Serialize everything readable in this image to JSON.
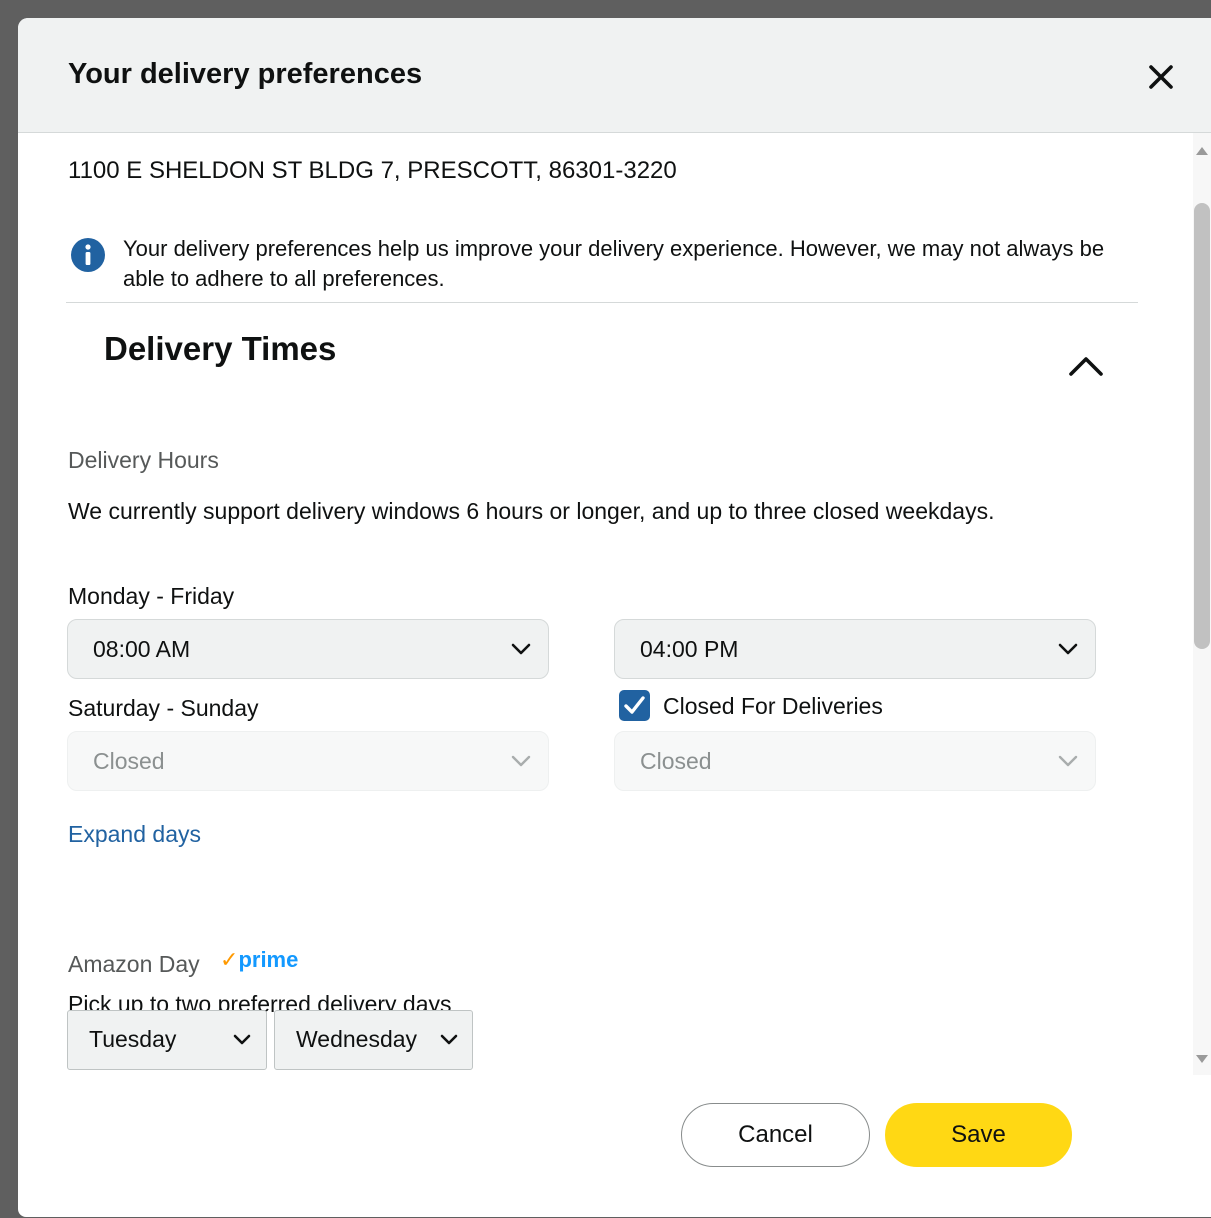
{
  "header": {
    "title": "Your delivery preferences",
    "close_icon": "close-icon"
  },
  "address": "1100 E SHELDON ST BLDG 7, PRESCOTT, 86301-3220",
  "info": {
    "icon": "info-icon",
    "text": "Your delivery preferences help us improve your delivery experience. However, we may not always be able to adhere to all preferences."
  },
  "delivery_times": {
    "title": "Delivery Times",
    "collapse_icon": "chevron-up-icon",
    "hours_label": "Delivery Hours",
    "description": "We currently support delivery windows 6 hours or longer, and up to three closed weekdays.",
    "weekday": {
      "label": "Monday - Friday",
      "start": "08:00 AM",
      "end": "04:00 PM"
    },
    "weekend": {
      "label": "Saturday - Sunday",
      "closed_label": "Closed For Deliveries",
      "closed_checked": true,
      "start": "Closed",
      "end": "Closed"
    },
    "expand_link": "Expand days"
  },
  "amazon_day": {
    "label": "Amazon Day",
    "prime_tick": "✓",
    "prime_text": "prime",
    "prompt": "Pick up to two preferred delivery days",
    "day1": "Tuesday",
    "day2": "Wednesday"
  },
  "footer": {
    "cancel_label": "Cancel",
    "save_label": "Save"
  },
  "colors": {
    "save_button": "#ffd814",
    "link": "#2162a1",
    "info_icon": "#2162a1",
    "prime": "#1399ff",
    "prime_check": "#ff9900"
  }
}
